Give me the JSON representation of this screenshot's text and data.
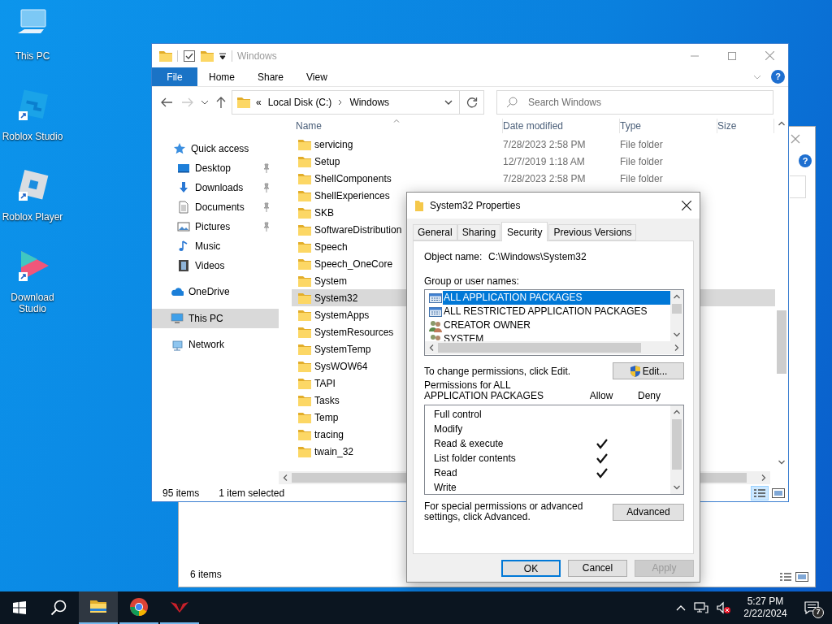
{
  "desktop_icons": [
    {
      "label": "This PC",
      "kind": "pc",
      "shortcut": false
    },
    {
      "label": "Roblox Studio",
      "kind": "studio",
      "shortcut": true
    },
    {
      "label": "Roblox Player",
      "kind": "player",
      "shortcut": true
    },
    {
      "label": "Download Studio",
      "kind": "ds",
      "shortcut": true
    }
  ],
  "background_window": {
    "help": "?",
    "status": "6 items"
  },
  "explorer": {
    "title": "Windows",
    "file_tab": "File",
    "ribbon_tabs": [
      "Home",
      "Share",
      "View"
    ],
    "help": "?",
    "address": {
      "overflow": "«",
      "segments": [
        "Local Disk (C:)",
        "Windows"
      ]
    },
    "search": {
      "placeholder": "Search Windows"
    },
    "nav": [
      {
        "label": "Quick access",
        "kind": "quick",
        "selected": false,
        "children": [
          {
            "label": "Desktop",
            "kind": "desktop",
            "selected": false,
            "pinned": true
          },
          {
            "label": "Downloads",
            "kind": "downloads",
            "selected": false,
            "pinned": true
          },
          {
            "label": "Documents",
            "kind": "documents",
            "selected": false,
            "pinned": true
          },
          {
            "label": "Pictures",
            "kind": "pictures",
            "selected": false,
            "pinned": true
          },
          {
            "label": "Music",
            "kind": "music",
            "selected": false,
            "pinned": false
          },
          {
            "label": "Videos",
            "kind": "videos",
            "selected": false,
            "pinned": false
          }
        ]
      },
      {
        "label": "OneDrive",
        "kind": "onedrive",
        "selected": false
      },
      {
        "label": "This PC",
        "kind": "pc",
        "selected": true
      },
      {
        "label": "Network",
        "kind": "network",
        "selected": false
      }
    ],
    "columns": [
      "Name",
      "Date modified",
      "Type",
      "Size"
    ],
    "rows": [
      {
        "name": "servicing",
        "date_modified": "7/28/2023 2:58 PM",
        "type": "File folder",
        "selected": false
      },
      {
        "name": "Setup",
        "date_modified": "12/7/2019 1:18 AM",
        "type": "File folder",
        "selected": false
      },
      {
        "name": "ShellComponents",
        "date_modified": "7/28/2023 2:58 PM",
        "type": "File folder",
        "selected": false
      },
      {
        "name": "ShellExperiences",
        "selected": false
      },
      {
        "name": "SKB",
        "selected": false
      },
      {
        "name": "SoftwareDistribution",
        "selected": false
      },
      {
        "name": "Speech",
        "selected": false
      },
      {
        "name": "Speech_OneCore",
        "selected": false
      },
      {
        "name": "System",
        "selected": false
      },
      {
        "name": "System32",
        "selected": true
      },
      {
        "name": "SystemApps",
        "selected": false
      },
      {
        "name": "SystemResources",
        "selected": false
      },
      {
        "name": "SystemTemp",
        "selected": false
      },
      {
        "name": "SysWOW64",
        "selected": false
      },
      {
        "name": "TAPI",
        "selected": false
      },
      {
        "name": "Tasks",
        "selected": false
      },
      {
        "name": "Temp",
        "selected": false
      },
      {
        "name": "tracing",
        "selected": false
      },
      {
        "name": "twain_32",
        "selected": false
      }
    ],
    "status": {
      "count": "95 items",
      "selection": "1 item selected"
    }
  },
  "dialog": {
    "title": "System32 Properties",
    "tabs": [
      {
        "label": "General",
        "selected": false
      },
      {
        "label": "Sharing",
        "selected": false
      },
      {
        "label": "Security",
        "selected": true
      },
      {
        "label": "Previous Versions",
        "selected": false
      }
    ],
    "object_name_label": "Object name:",
    "object_name": "C:\\Windows\\System32",
    "groups_label": "Group or user names:",
    "groups": [
      {
        "name": "ALL APPLICATION PACKAGES",
        "kind": "package",
        "selected": true
      },
      {
        "name": "ALL RESTRICTED APPLICATION PACKAGES",
        "kind": "package",
        "selected": false
      },
      {
        "name": "CREATOR OWNER",
        "kind": "users",
        "selected": false
      },
      {
        "name": "SYSTEM",
        "kind": "users",
        "selected": false
      }
    ],
    "change_hint": "To change permissions, click Edit.",
    "edit_button": "Edit...",
    "permissions_label": "Permissions for ALL APPLICATION PACKAGES",
    "allow_label": "Allow",
    "deny_label": "Deny",
    "permissions": [
      {
        "name": "Full control",
        "allow": false,
        "deny": false
      },
      {
        "name": "Modify",
        "allow": false,
        "deny": false
      },
      {
        "name": "Read & execute",
        "allow": true,
        "deny": false
      },
      {
        "name": "List folder contents",
        "allow": true,
        "deny": false
      },
      {
        "name": "Read",
        "allow": true,
        "deny": false
      },
      {
        "name": "Write",
        "allow": false,
        "deny": false
      }
    ],
    "advanced_hint": "For special permissions or advanced settings, click Advanced.",
    "advanced_button": "Advanced",
    "buttons": [
      {
        "label": "OK",
        "kind": "default",
        "disabled": false
      },
      {
        "label": "Cancel",
        "kind": "normal",
        "disabled": false
      },
      {
        "label": "Apply",
        "kind": "normal",
        "disabled": true
      }
    ]
  },
  "taskbar": {
    "apps": [
      {
        "kind": "explorer",
        "active": true
      },
      {
        "kind": "chrome",
        "active": false
      },
      {
        "kind": "emblem",
        "active": false
      }
    ],
    "time": "5:27 PM",
    "date": "2/22/2024",
    "notifications": "7"
  }
}
